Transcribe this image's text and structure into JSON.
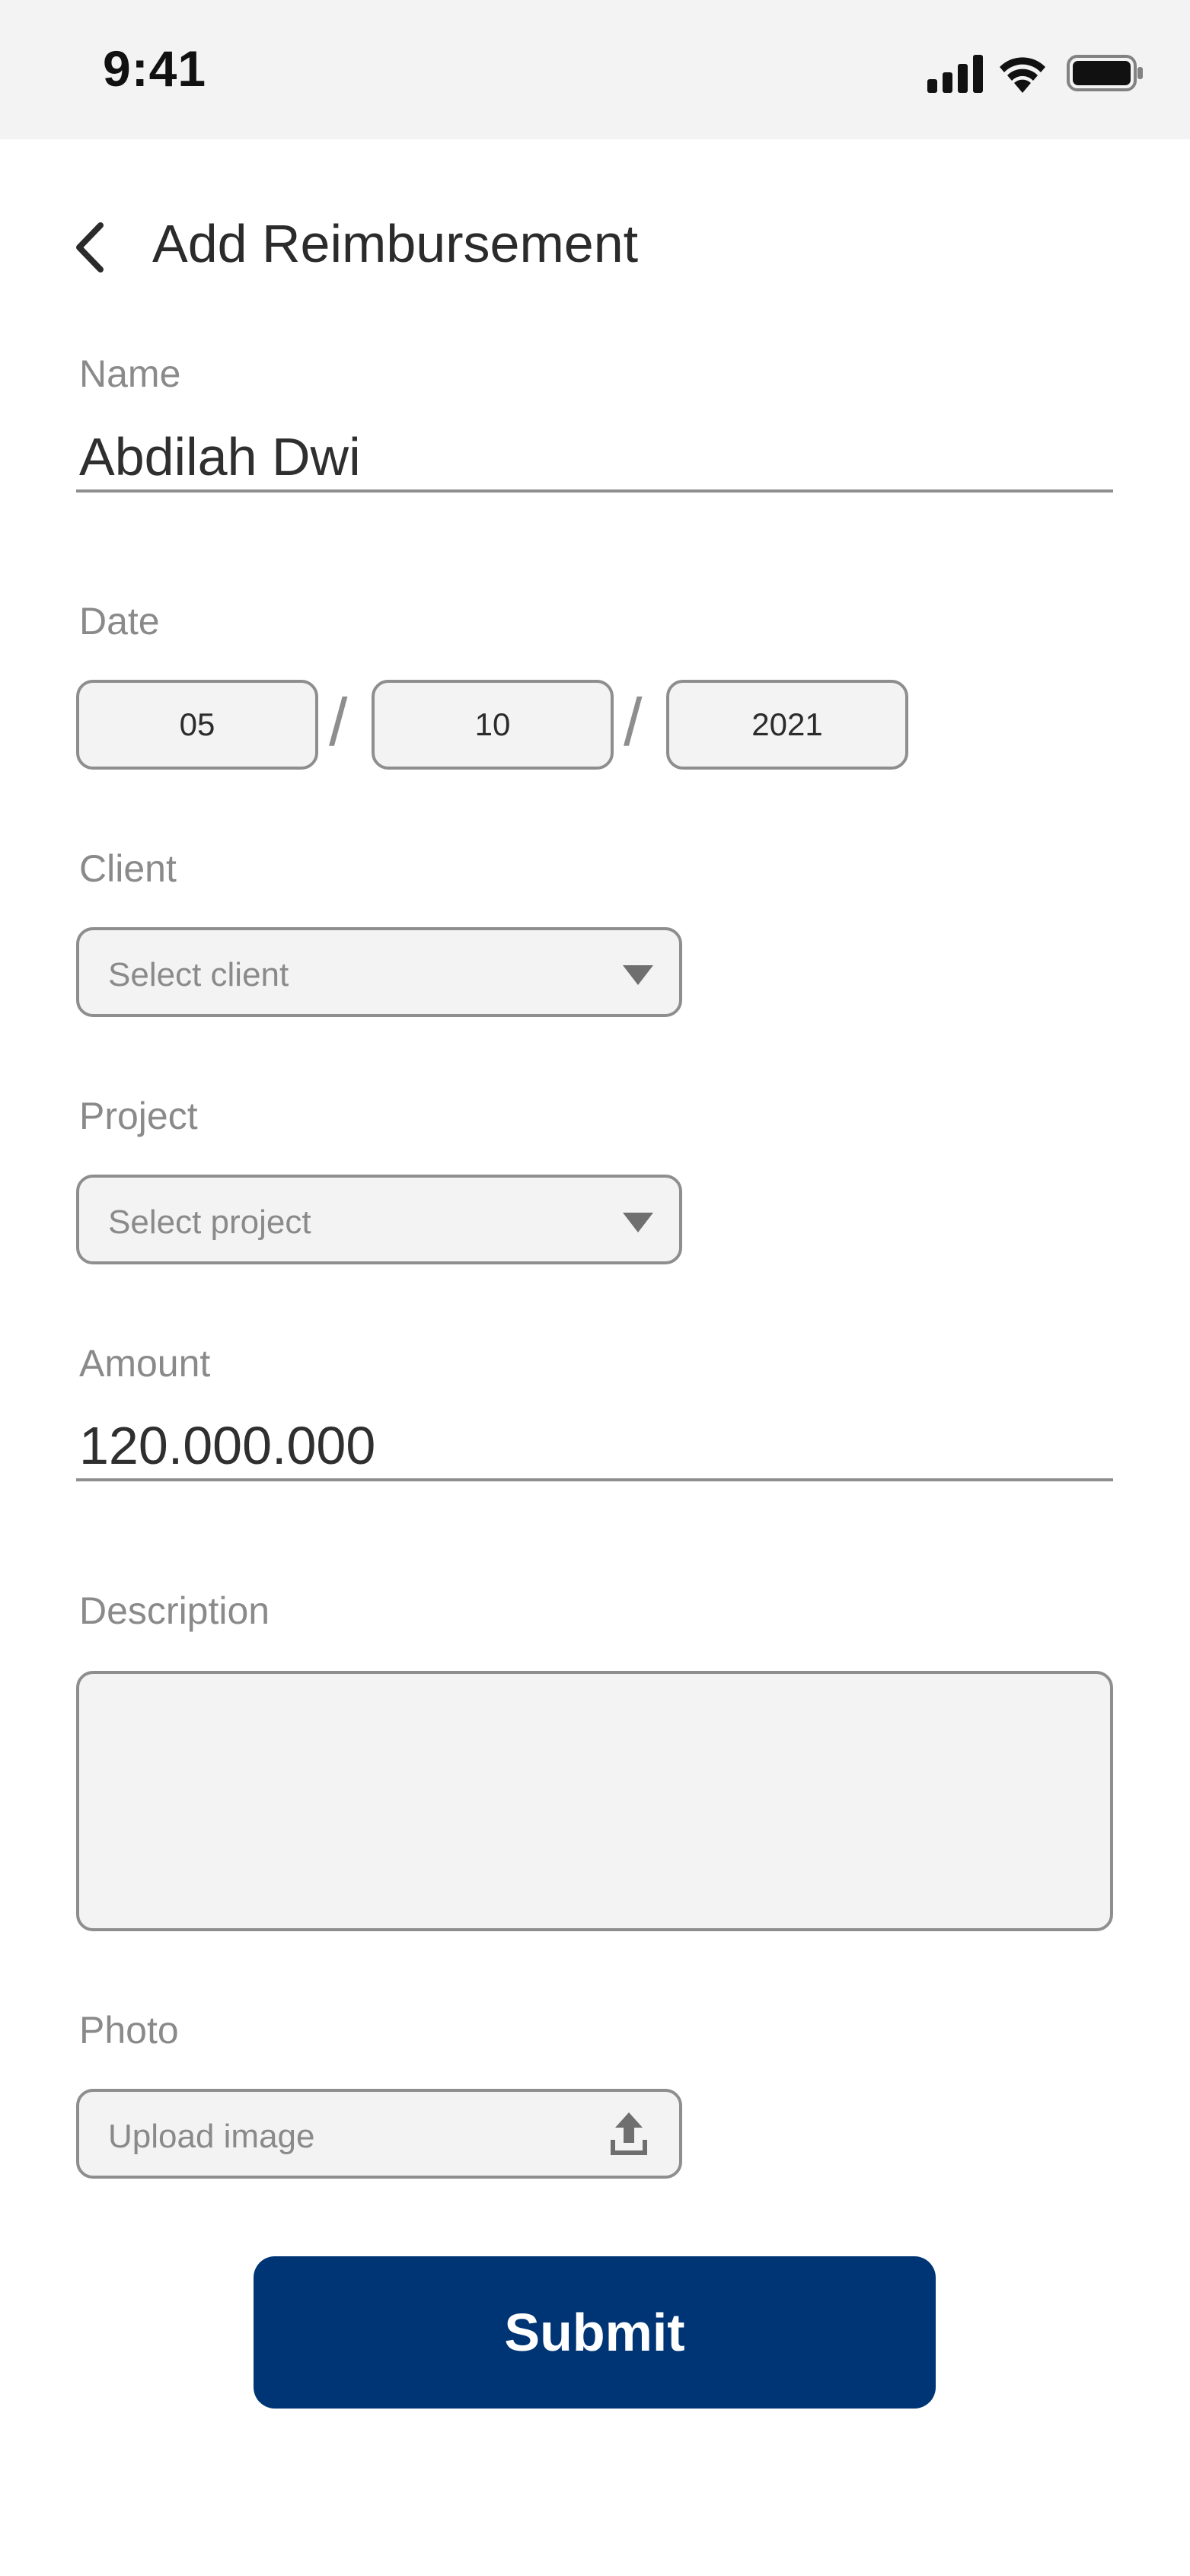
{
  "status_bar": {
    "time": "9:41"
  },
  "header": {
    "title": "Add Reimbursement"
  },
  "form": {
    "name": {
      "label": "Name",
      "value": "Abdilah Dwi"
    },
    "date": {
      "label": "Date",
      "day": "05",
      "month": "10",
      "year": "2021",
      "separator": "/"
    },
    "client": {
      "label": "Client",
      "placeholder": "Select client"
    },
    "project": {
      "label": "Project",
      "placeholder": "Select project"
    },
    "amount": {
      "label": "Amount",
      "value": "120.000.000"
    },
    "description": {
      "label": "Description",
      "value": ""
    },
    "photo": {
      "label": "Photo",
      "placeholder": "Upload image"
    },
    "submit_label": "Submit"
  },
  "icons": {
    "back": "chevron-left-icon",
    "dropdown": "caret-down-icon",
    "upload": "upload-icon",
    "signal": "signal-icon",
    "wifi": "wifi-icon",
    "battery": "battery-icon"
  },
  "colors": {
    "primary": "#003575",
    "status_bar_bg": "#f3f3f3",
    "field_bg": "#f3f3f3",
    "field_border": "#8e8e8e",
    "label": "#8a8a8a"
  }
}
